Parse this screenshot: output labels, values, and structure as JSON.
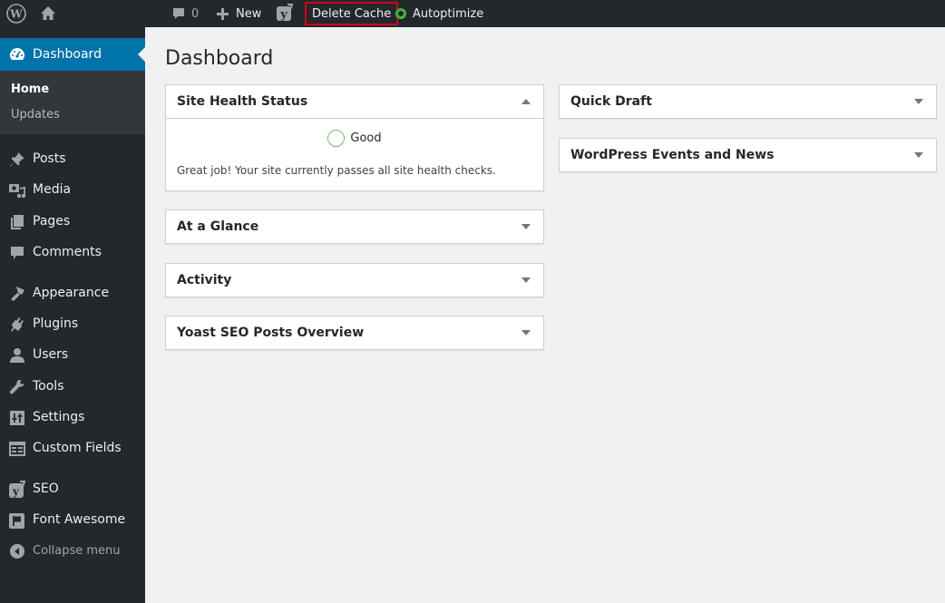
{
  "admin_bar": {
    "comments_count": "0",
    "new_label": "New",
    "delete_cache_label": "Delete Cache",
    "autoptimize_label": "Autoptimize",
    "autoptimize_status_color": "#3bb83b",
    "highlight_color": "#d0021b"
  },
  "sidebar": {
    "current": {
      "label": "Dashboard",
      "icon": "dashboard-icon"
    },
    "submenu": [
      {
        "label": "Home",
        "active": true
      },
      {
        "label": "Updates",
        "active": false
      }
    ],
    "items": [
      {
        "label": "Posts",
        "icon": "pin-icon"
      },
      {
        "label": "Media",
        "icon": "media-icon"
      },
      {
        "label": "Pages",
        "icon": "pages-icon"
      },
      {
        "label": "Comments",
        "icon": "comment-icon"
      },
      {
        "label": "Appearance",
        "icon": "paintbrush-icon"
      },
      {
        "label": "Plugins",
        "icon": "plug-icon"
      },
      {
        "label": "Users",
        "icon": "user-icon"
      },
      {
        "label": "Tools",
        "icon": "wrench-icon"
      },
      {
        "label": "Settings",
        "icon": "settings-icon"
      },
      {
        "label": "Custom Fields",
        "icon": "table-icon"
      },
      {
        "label": "SEO",
        "icon": "yoast-icon"
      },
      {
        "label": "Font Awesome",
        "icon": "flag-icon"
      }
    ],
    "collapse_label": "Collapse menu",
    "accent_color": "#0073aa"
  },
  "main": {
    "title": "Dashboard",
    "left_column": [
      {
        "title": "Site Health Status",
        "expanded": true,
        "status": "Good",
        "message": "Great job! Your site currently passes all site health checks."
      },
      {
        "title": "At a Glance",
        "expanded": false
      },
      {
        "title": "Activity",
        "expanded": false
      },
      {
        "title": "Yoast SEO Posts Overview",
        "expanded": false
      }
    ],
    "right_column": [
      {
        "title": "Quick Draft",
        "expanded": false
      },
      {
        "title": "WordPress Events and News",
        "expanded": false
      }
    ]
  }
}
